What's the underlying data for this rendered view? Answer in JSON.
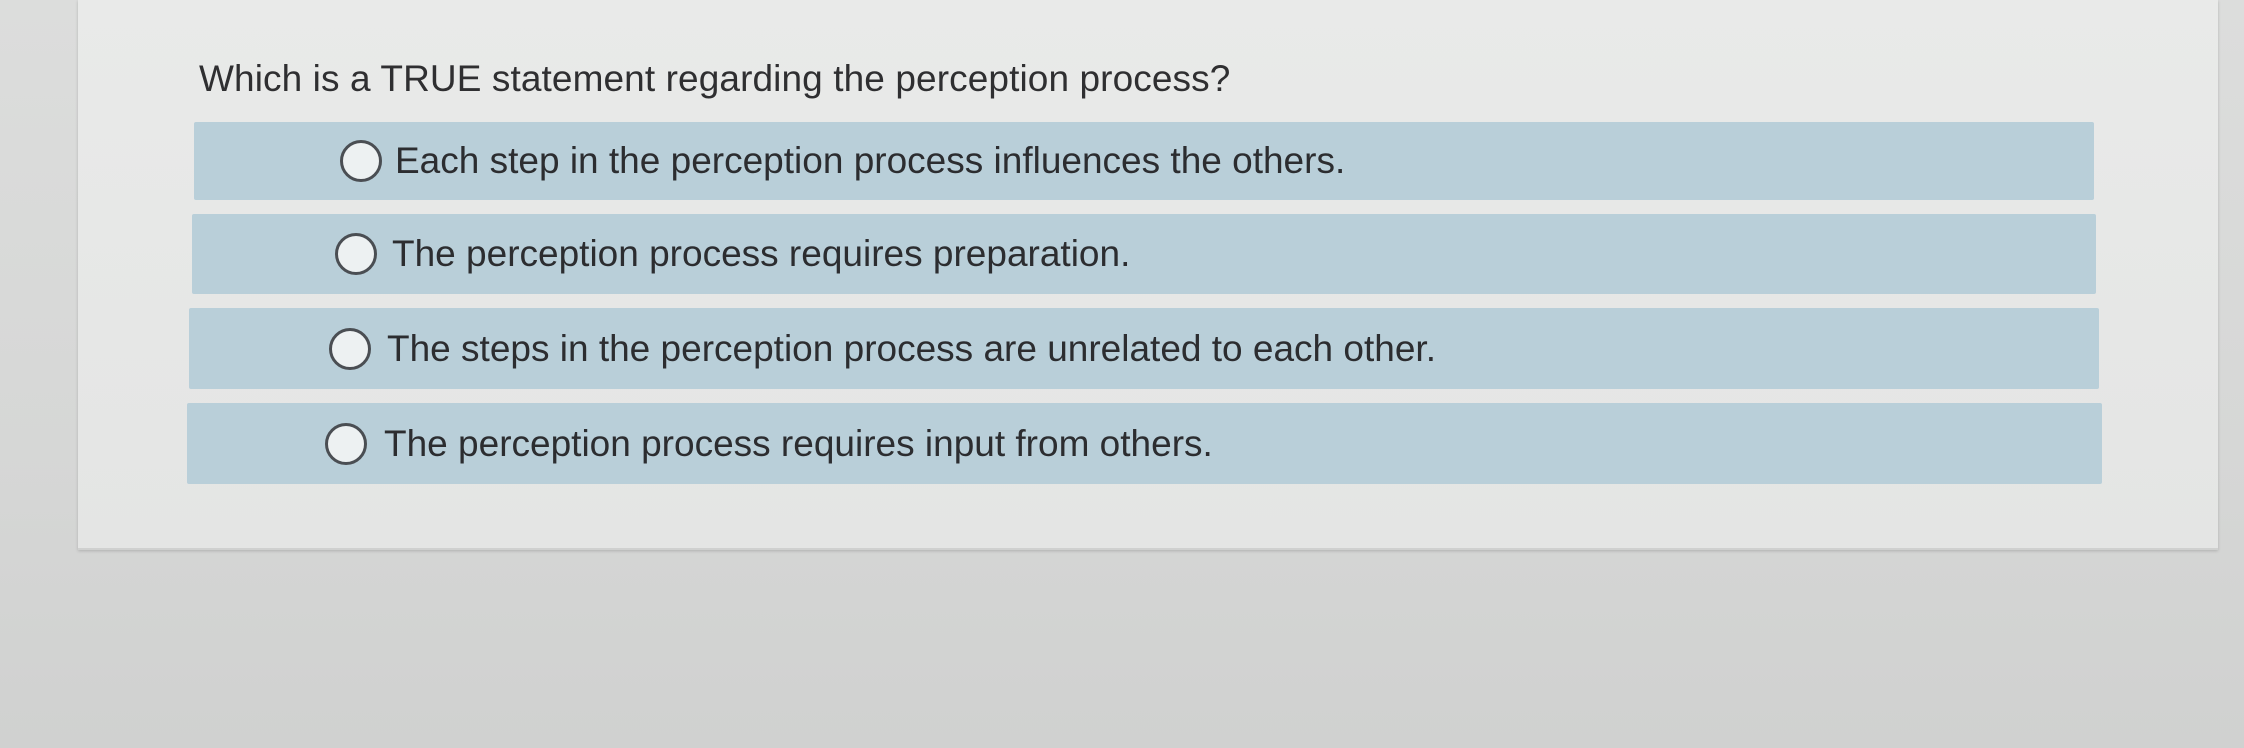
{
  "question": {
    "text": "Which is a TRUE statement regarding the perception process?"
  },
  "choices": [
    {
      "label": "Each step in the perception process influences the others.",
      "selected": false
    },
    {
      "label": "The perception process requires preparation.",
      "selected": false
    },
    {
      "label": "The steps in the perception process are unrelated to each other.",
      "selected": false
    },
    {
      "label": "The perception process requires input from others.",
      "selected": false
    }
  ],
  "colors": {
    "choice_background": "#b9cfd9",
    "card_background": "#e9eae9",
    "page_background": "#d8d9d8",
    "text": "#2c2d30"
  }
}
